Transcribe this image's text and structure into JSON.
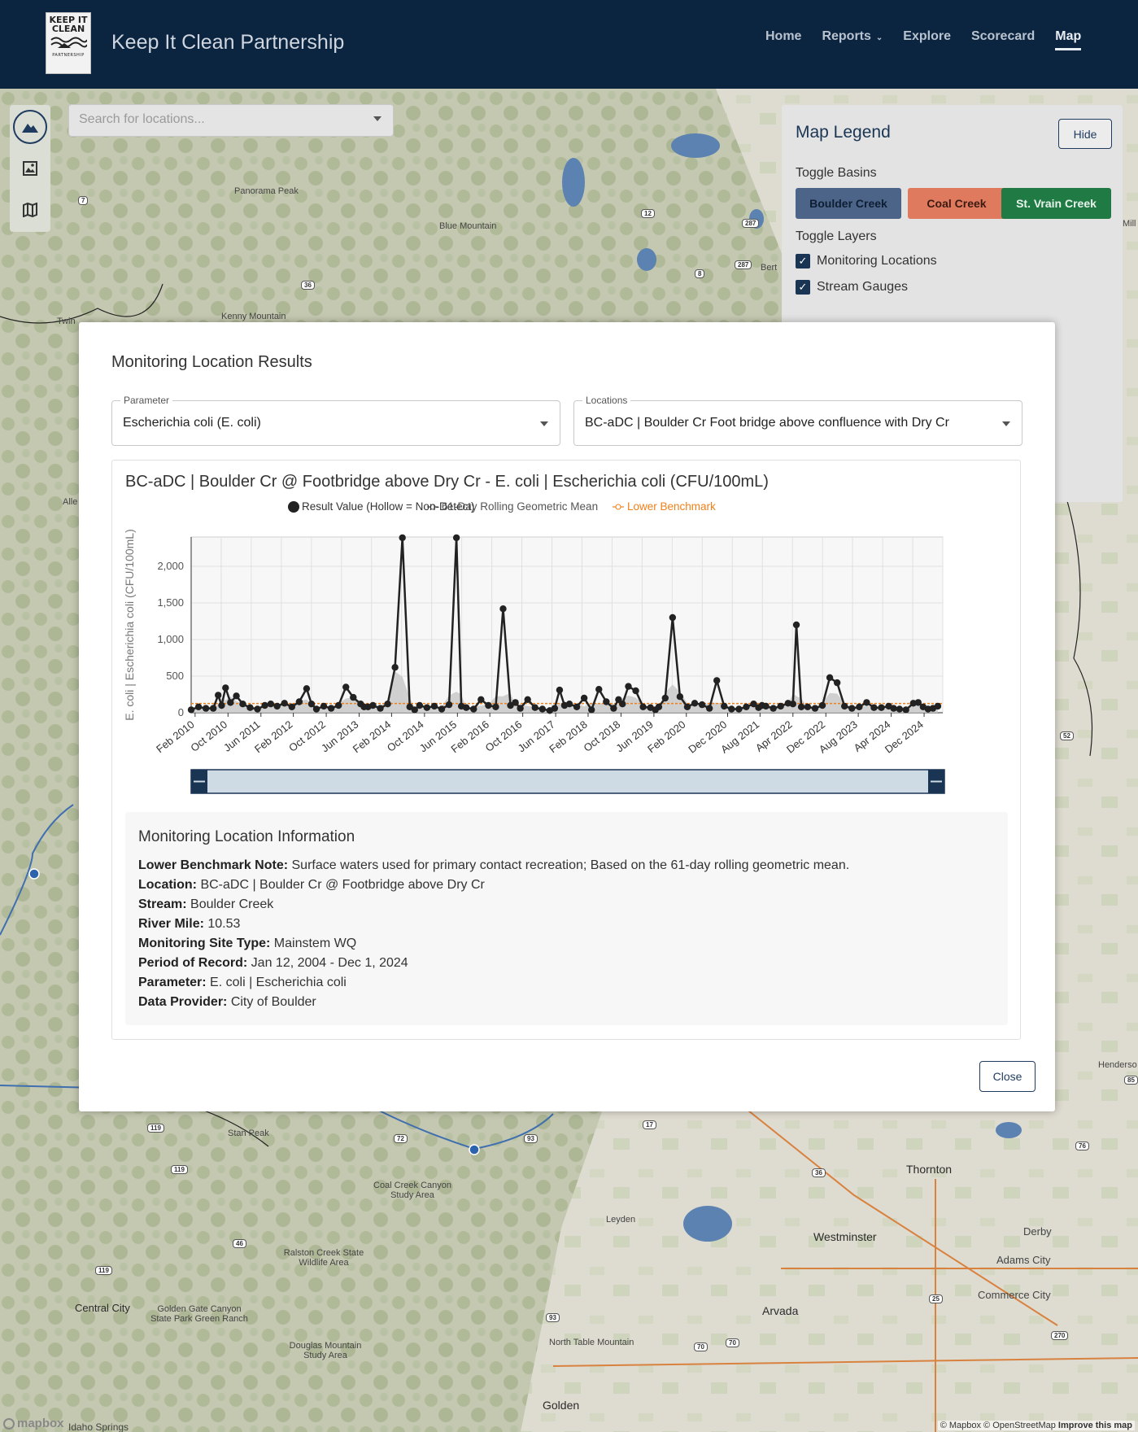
{
  "header": {
    "logo_lines": [
      "KEEP IT",
      "CLEAN"
    ],
    "logo_subtext": "PARTNERSHIP",
    "site_title": "Keep It Clean Partnership",
    "nav": [
      {
        "label": "Home"
      },
      {
        "label": "Reports",
        "has_dropdown": true
      },
      {
        "label": "Explore"
      },
      {
        "label": "Scorecard"
      },
      {
        "label": "Map",
        "active": true
      }
    ]
  },
  "map": {
    "search_placeholder": "Search for locations...",
    "tools": [
      "mountain-icon",
      "image-icon",
      "map-icon"
    ],
    "labels": {
      "panorama": "Panorama Peak",
      "blue": "Blue Mountain",
      "kenny": "Kenny Mountain",
      "twin": "Twin",
      "bert": "Bert",
      "mill": "Mill",
      "alle": "Alle",
      "stan": "Stan Peak",
      "coal_creek": "Coal Creek Canyon Study Area",
      "leyden": "Leyden",
      "ralston": "Ralston Creek State Wildlife Area",
      "golden_gate": "Golden Gate Canyon State Park Green Ranch",
      "central_city": "Central City",
      "douglas": "Douglas Mountain Study Area",
      "north_table": "North Table Mountain",
      "golden": "Golden",
      "idaho": "Idaho Springs",
      "thornton": "Thornton",
      "westminster": "Westminster",
      "derby": "Derby",
      "adams_city": "Adams City",
      "commerce_city": "Commerce City",
      "arvada": "Arvada",
      "henderson": "Henderso"
    },
    "highways": [
      "7",
      "12",
      "287",
      "287",
      "8",
      "36",
      "52",
      "119",
      "119",
      "46",
      "119",
      "72",
      "93",
      "17",
      "93",
      "36",
      "76",
      "25",
      "70",
      "70",
      "270",
      "85"
    ],
    "attribution": "© Mapbox © OpenStreetMap",
    "improve": "Improve this map",
    "mapbox": "mapbox"
  },
  "legend": {
    "title": "Map Legend",
    "hide_label": "Hide",
    "toggle_basins_label": "Toggle Basins",
    "basins": [
      {
        "label": "Boulder Creek",
        "color": "#4b6488",
        "text_color": "#0e1e33"
      },
      {
        "label": "Coal Creek",
        "color": "#e07a5f",
        "text_color": "#3b1a10"
      },
      {
        "label": "St. Vrain Creek",
        "color": "#1f7a44",
        "text_color": "#e8f3ec"
      }
    ],
    "toggle_layers_label": "Toggle Layers",
    "layers": [
      {
        "label": "Monitoring Locations",
        "checked": true
      },
      {
        "label": "Stream Gauges",
        "checked": true
      }
    ]
  },
  "modal": {
    "title": "Monitoring Location Results",
    "parameter": {
      "label": "Parameter",
      "value": "Escherichia coli (E. coli)"
    },
    "locations": {
      "label": "Locations",
      "value": "BC-aDC | Boulder Cr Foot bridge above confluence with Dry Cr"
    },
    "close_label": "Close",
    "info": {
      "title": "Monitoring Location Information",
      "rows": [
        {
          "label": "Lower Benchmark Note:",
          "value": "Surface waters used for primary contact recreation; Based on the 61-day rolling geometric mean."
        },
        {
          "label": "Location:",
          "value": "BC-aDC | Boulder Cr @ Footbridge above Dry Cr"
        },
        {
          "label": "Stream:",
          "value": "Boulder Creek"
        },
        {
          "label": "River Mile:",
          "value": "10.53"
        },
        {
          "label": "Monitoring Site Type:",
          "value": "Mainstem WQ"
        },
        {
          "label": "Period of Record:",
          "value": "Jan 12, 2004 - Dec 1, 2024"
        },
        {
          "label": "Parameter:",
          "value": "E. coli | Escherichia coli"
        },
        {
          "label": "Data Provider:",
          "value": "City of Boulder"
        }
      ]
    }
  },
  "chart_data": {
    "type": "line",
    "title": "BC-aDC | Boulder Cr @ Footbridge above Dry Cr - E. coli | Escherichia coli (CFU/100mL)",
    "ylabel": "E. coli | Escherichia coli (CFU/100mL)",
    "xlabel": "",
    "ylim": [
      0,
      2400
    ],
    "yticks": [
      0,
      500,
      1000,
      1500,
      2000
    ],
    "ytick_labels": [
      "0",
      "500",
      "1,000",
      "1,500",
      "2,000"
    ],
    "xlim": [
      2010.0,
      2025.3
    ],
    "xtick_labels": [
      "Feb 2010",
      "Oct 2010",
      "Jun 2011",
      "Feb 2012",
      "Oct 2012",
      "Jun 2013",
      "Feb 2014",
      "Oct 2014",
      "Jun 2015",
      "Feb 2016",
      "Oct 2016",
      "Jun 2017",
      "Feb 2018",
      "Oct 2018",
      "Jun 2019",
      "Feb 2020",
      "Dec 2020",
      "Aug 2021",
      "Apr 2022",
      "Dec 2022",
      "Aug 2023",
      "Apr 2024",
      "Dec 2024"
    ],
    "xtick_values": [
      2010.08,
      2010.75,
      2011.42,
      2012.08,
      2012.75,
      2013.42,
      2014.08,
      2014.75,
      2015.42,
      2016.08,
      2016.75,
      2017.42,
      2018.08,
      2018.75,
      2019.42,
      2020.08,
      2020.92,
      2021.58,
      2022.25,
      2022.92,
      2023.58,
      2024.25,
      2024.92
    ],
    "grid": true,
    "legend_position": "top",
    "benchmark_value": 126,
    "legend": [
      {
        "label": "Result Value (Hollow = Non-Detect)",
        "color": "#222222"
      },
      {
        "label": "61-Day Rolling Geometric Mean",
        "color": "#555555"
      },
      {
        "label": "Lower Benchmark",
        "color": "#f0801a"
      }
    ],
    "series": [
      {
        "name": "Result Value (Hollow = Non-Detect)",
        "x": [
          2010.0,
          2010.15,
          2010.3,
          2010.45,
          2010.55,
          2010.62,
          2010.7,
          2010.8,
          2010.92,
          2011.05,
          2011.2,
          2011.35,
          2011.5,
          2011.62,
          2011.75,
          2011.9,
          2012.05,
          2012.2,
          2012.35,
          2012.45,
          2012.55,
          2012.7,
          2012.85,
          2013.0,
          2013.15,
          2013.3,
          2013.45,
          2013.52,
          2013.6,
          2013.7,
          2013.85,
          2014.0,
          2014.15,
          2014.3,
          2014.45,
          2014.55,
          2014.65,
          2014.8,
          2014.95,
          2015.1,
          2015.25,
          2015.4,
          2015.5,
          2015.6,
          2015.75,
          2015.9,
          2016.05,
          2016.2,
          2016.35,
          2016.5,
          2016.6,
          2016.7,
          2016.85,
          2017.0,
          2017.15,
          2017.3,
          2017.4,
          2017.5,
          2017.6,
          2017.7,
          2017.85,
          2018.0,
          2018.15,
          2018.3,
          2018.45,
          2018.6,
          2018.7,
          2018.78,
          2018.9,
          2019.05,
          2019.2,
          2019.35,
          2019.45,
          2019.52,
          2019.65,
          2019.8,
          2019.95,
          2020.1,
          2020.25,
          2020.4,
          2020.55,
          2020.7,
          2020.85,
          2021.0,
          2021.15,
          2021.3,
          2021.45,
          2021.55,
          2021.62,
          2021.7,
          2021.85,
          2022.0,
          2022.15,
          2022.25,
          2022.32,
          2022.42,
          2022.55,
          2022.7,
          2022.85,
          2023.0,
          2023.15,
          2023.3,
          2023.45,
          2023.6,
          2023.75,
          2023.9,
          2024.05,
          2024.2,
          2024.3,
          2024.42,
          2024.55,
          2024.7,
          2024.8,
          2024.9,
          2025.0,
          2025.1,
          2025.2
        ],
        "values": [
          40,
          80,
          60,
          60,
          240,
          100,
          340,
          140,
          230,
          120,
          70,
          50,
          100,
          120,
          90,
          130,
          80,
          150,
          330,
          120,
          50,
          90,
          60,
          100,
          350,
          210,
          120,
          80,
          80,
          100,
          60,
          120,
          620,
          2390,
          80,
          40,
          100,
          70,
          90,
          50,
          110,
          2390,
          90,
          70,
          50,
          180,
          100,
          80,
          1420,
          100,
          140,
          60,
          180,
          70,
          50,
          30,
          60,
          310,
          100,
          120,
          80,
          200,
          40,
          320,
          150,
          60,
          180,
          120,
          360,
          300,
          80,
          70,
          40,
          80,
          200,
          1300,
          220,
          80,
          130,
          110,
          60,
          440,
          90,
          50,
          50,
          80,
          120,
          70,
          100,
          90,
          60,
          90,
          130,
          120,
          1200,
          80,
          80,
          60,
          100,
          480,
          410,
          90,
          60,
          80,
          140,
          70,
          70,
          90,
          60,
          50,
          40,
          130,
          140,
          80,
          50,
          60,
          90
        ],
        "color": "#222222"
      }
    ]
  }
}
